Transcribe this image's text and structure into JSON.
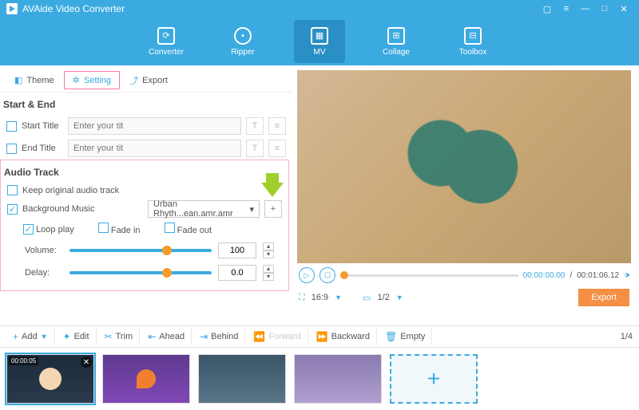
{
  "app": {
    "title": "AVAide Video Converter"
  },
  "nav": {
    "items": [
      {
        "label": "Converter"
      },
      {
        "label": "Ripper"
      },
      {
        "label": "MV"
      },
      {
        "label": "Collage"
      },
      {
        "label": "Toolbox"
      }
    ]
  },
  "tabs": {
    "theme": "Theme",
    "setting": "Setting",
    "export": "Export"
  },
  "startend": {
    "heading": "Start & End",
    "start_label": "Start Title",
    "end_label": "End Title",
    "placeholder": "Enter your tit"
  },
  "audio": {
    "heading": "Audio Track",
    "keep_label": "Keep original audio track",
    "bgm_label": "Background Music",
    "bgm_value": "Urban Rhyth...ean.amr.amr",
    "loop_label": "Loop play",
    "fadein_label": "Fade in",
    "fadeout_label": "Fade out",
    "volume_label": "Volume:",
    "volume_value": "100",
    "delay_label": "Delay:",
    "delay_value": "0.0"
  },
  "preview": {
    "time_cur": "00:00:00.00",
    "time_total": "00:01:06.12",
    "ratio": "16:9",
    "page": "1/2",
    "export": "Export"
  },
  "toolbar": {
    "add": "Add",
    "edit": "Edit",
    "trim": "Trim",
    "ahead": "Ahead",
    "behind": "Behind",
    "forward": "Forward",
    "backward": "Backward",
    "empty": "Empty",
    "pager": "1/4"
  },
  "thumbs": {
    "dur1": "00:00:05"
  }
}
